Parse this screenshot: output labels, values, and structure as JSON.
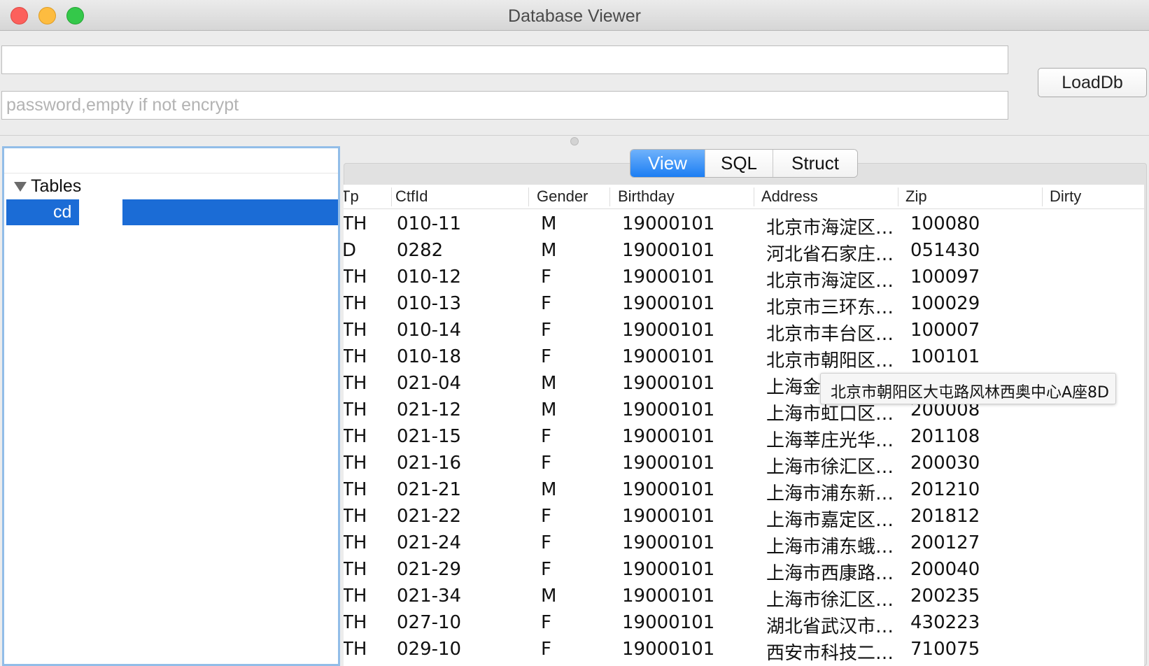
{
  "window": {
    "title": "Database Viewer"
  },
  "form": {
    "path_value": "",
    "password_placeholder": "password,empty if not encrypt",
    "load_button": "LoadDb"
  },
  "sidebar": {
    "section_label": "Tables",
    "items": [
      {
        "label": "cd"
      }
    ]
  },
  "tabs": [
    {
      "label": "View",
      "active": true
    },
    {
      "label": "SQL",
      "active": false
    },
    {
      "label": "Struct",
      "active": false
    }
  ],
  "table": {
    "columns": [
      "Tp",
      "CtfId",
      "Gender",
      "Birthday",
      "Address",
      "Zip",
      "Dirty"
    ],
    "rows": [
      [
        "TH",
        "010-11",
        "M",
        "19000101",
        "北京市海淀区…",
        "100080"
      ],
      [
        "D",
        "0282",
        "M",
        "19000101",
        "河北省石家庄…",
        "051430"
      ],
      [
        "TH",
        "010-12",
        "F",
        "19000101",
        "北京市海淀区…",
        "100097"
      ],
      [
        "TH",
        "010-13",
        "F",
        "19000101",
        "北京市三环东…",
        "100029"
      ],
      [
        "TH",
        "010-14",
        "F",
        "19000101",
        "北京市丰台区…",
        "100007"
      ],
      [
        "TH",
        "010-18",
        "F",
        "19000101",
        "北京市朝阳区…",
        "100101"
      ],
      [
        "TH",
        "021-04",
        "M",
        "19000101",
        "上海金",
        ""
      ],
      [
        "TH",
        "021-12",
        "M",
        "19000101",
        "上海市虹口区…",
        "200008"
      ],
      [
        "TH",
        "021-15",
        "F",
        "19000101",
        "上海莘庄光华…",
        "201108"
      ],
      [
        "TH",
        "021-16",
        "F",
        "19000101",
        "上海市徐汇区…",
        "200030"
      ],
      [
        "TH",
        "021-21",
        "M",
        "19000101",
        "上海市浦东新…",
        "201210"
      ],
      [
        "TH",
        "021-22",
        "F",
        "19000101",
        "上海市嘉定区…",
        "201812"
      ],
      [
        "TH",
        "021-24",
        "F",
        "19000101",
        "上海市浦东蛾…",
        "200127"
      ],
      [
        "TH",
        "021-29",
        "F",
        "19000101",
        "上海市西康路…",
        "200040"
      ],
      [
        "TH",
        "021-34",
        "M",
        "19000101",
        "上海市徐汇区…",
        "200235"
      ],
      [
        "TH",
        "027-10",
        "F",
        "19000101",
        "湖北省武汉市…",
        "430223"
      ],
      [
        "TH",
        "029-10",
        "F",
        "19000101",
        "西安市科技二…",
        "710075"
      ]
    ]
  },
  "tooltip": {
    "text": "北京市朝阳区大屯路风林西奥中心A座8D"
  }
}
